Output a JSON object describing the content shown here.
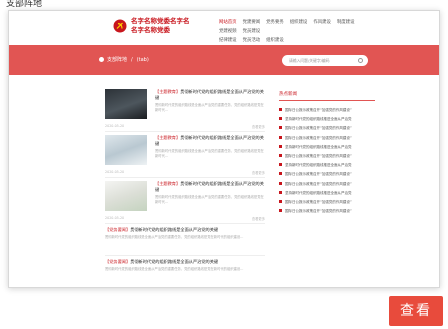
{
  "caption": "支部阵地",
  "brand": {
    "line1": "名字名称党委名字名",
    "line2": "名字名称党委"
  },
  "nav": {
    "row1": [
      "网站首页",
      "党建要闻",
      "党务要务",
      "组织建设",
      "作风建设",
      "制度建设",
      "党建视频",
      "党员建设"
    ],
    "row2": [
      "纪律建设",
      "党员活动",
      "组织建设"
    ],
    "active_index": 0
  },
  "breadcrumb": {
    "home": "支部阵地",
    "separator": "/",
    "current": "(tab)"
  },
  "search": {
    "placeholder": "请输入问题/关键字/编码"
  },
  "articles": [
    {
      "tag": "【主题教育】",
      "title": "贯彻新时代党的组织路线是全面从严治党的关键",
      "desc": "贯彻新时代党的组织路线是全面从严治党的重要任务，党的组织路线是党在新时代…",
      "date": "2020-05-20",
      "more": "查看更多"
    },
    {
      "tag": "【主题教育】",
      "title": "贯彻新时代党的组织路线是全面从严治党的关键",
      "desc": "贯彻新时代党的组织路线是全面从严治党的重要任务，党的组织路线是党在新时代…",
      "date": "2020-05-20",
      "more": "查看更多"
    },
    {
      "tag": "【主题教育】",
      "title": "贯彻新时代党的组织路线是全面从严治党的关键",
      "desc": "贯彻新时代党的组织路线是全面从严治党的重要任务，党的组织路线是党在新时代…",
      "date": "2020-05-20",
      "more": "查看更多"
    }
  ],
  "text_articles": [
    {
      "tag": "【党务要闻】",
      "title": "贯彻新时代党的组织路线是全面从严治党的关键",
      "desc": "贯彻新时代党的组织路线是全面从严治党的重要任务，党的组织路线是党在新时代的组织建设…"
    },
    {
      "tag": "【党务要闻】",
      "title": "贯彻新时代党的组织路线是全面从严治党的关键",
      "desc": "贯彻新时代党的组织路线是全面从严治党的重要任务，党的组织路线是党在新时代的组织建设…"
    }
  ],
  "aside": {
    "title": "热点新闻",
    "items": [
      "国际日公报示政策召开“加强党的作风建设”",
      "坚持新时代党的组织路线推进全面从严治党",
      "国际日公报示政策召开“加强党的作风建设”",
      "国际日公报示政策召开“加强党的作风建设”",
      "坚持新时代党的组织路线推进全面从严治党",
      "国际日公报示政策召开“加强党的作风建设”",
      "坚持新时代党的组织路线推进全面从严治党",
      "国际日公报示政策召开“加强党的作风建设”",
      "国际日公报示政策召开“加强党的作风建设”",
      "坚持新时代党的组织路线推进全面从严治党",
      "国际日公报示政策召开“加强党的作风建设”",
      "国际日公报示政策召开“加强党的作风建设”"
    ]
  },
  "view_button": "查看",
  "colors": {
    "accent": "#c8161d",
    "banner": "#e15553",
    "button": "#e84b3c"
  }
}
